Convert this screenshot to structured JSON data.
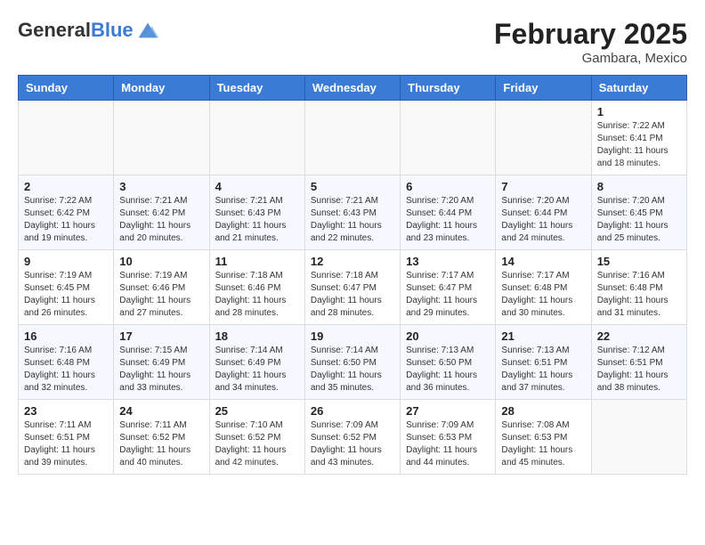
{
  "header": {
    "logo_general": "General",
    "logo_blue": "Blue",
    "month_year": "February 2025",
    "location": "Gambara, Mexico"
  },
  "calendar": {
    "days_of_week": [
      "Sunday",
      "Monday",
      "Tuesday",
      "Wednesday",
      "Thursday",
      "Friday",
      "Saturday"
    ],
    "weeks": [
      [
        {
          "day": "",
          "info": ""
        },
        {
          "day": "",
          "info": ""
        },
        {
          "day": "",
          "info": ""
        },
        {
          "day": "",
          "info": ""
        },
        {
          "day": "",
          "info": ""
        },
        {
          "day": "",
          "info": ""
        },
        {
          "day": "1",
          "info": "Sunrise: 7:22 AM\nSunset: 6:41 PM\nDaylight: 11 hours and 18 minutes."
        }
      ],
      [
        {
          "day": "2",
          "info": "Sunrise: 7:22 AM\nSunset: 6:42 PM\nDaylight: 11 hours and 19 minutes."
        },
        {
          "day": "3",
          "info": "Sunrise: 7:21 AM\nSunset: 6:42 PM\nDaylight: 11 hours and 20 minutes."
        },
        {
          "day": "4",
          "info": "Sunrise: 7:21 AM\nSunset: 6:43 PM\nDaylight: 11 hours and 21 minutes."
        },
        {
          "day": "5",
          "info": "Sunrise: 7:21 AM\nSunset: 6:43 PM\nDaylight: 11 hours and 22 minutes."
        },
        {
          "day": "6",
          "info": "Sunrise: 7:20 AM\nSunset: 6:44 PM\nDaylight: 11 hours and 23 minutes."
        },
        {
          "day": "7",
          "info": "Sunrise: 7:20 AM\nSunset: 6:44 PM\nDaylight: 11 hours and 24 minutes."
        },
        {
          "day": "8",
          "info": "Sunrise: 7:20 AM\nSunset: 6:45 PM\nDaylight: 11 hours and 25 minutes."
        }
      ],
      [
        {
          "day": "9",
          "info": "Sunrise: 7:19 AM\nSunset: 6:45 PM\nDaylight: 11 hours and 26 minutes."
        },
        {
          "day": "10",
          "info": "Sunrise: 7:19 AM\nSunset: 6:46 PM\nDaylight: 11 hours and 27 minutes."
        },
        {
          "day": "11",
          "info": "Sunrise: 7:18 AM\nSunset: 6:46 PM\nDaylight: 11 hours and 28 minutes."
        },
        {
          "day": "12",
          "info": "Sunrise: 7:18 AM\nSunset: 6:47 PM\nDaylight: 11 hours and 28 minutes."
        },
        {
          "day": "13",
          "info": "Sunrise: 7:17 AM\nSunset: 6:47 PM\nDaylight: 11 hours and 29 minutes."
        },
        {
          "day": "14",
          "info": "Sunrise: 7:17 AM\nSunset: 6:48 PM\nDaylight: 11 hours and 30 minutes."
        },
        {
          "day": "15",
          "info": "Sunrise: 7:16 AM\nSunset: 6:48 PM\nDaylight: 11 hours and 31 minutes."
        }
      ],
      [
        {
          "day": "16",
          "info": "Sunrise: 7:16 AM\nSunset: 6:48 PM\nDaylight: 11 hours and 32 minutes."
        },
        {
          "day": "17",
          "info": "Sunrise: 7:15 AM\nSunset: 6:49 PM\nDaylight: 11 hours and 33 minutes."
        },
        {
          "day": "18",
          "info": "Sunrise: 7:14 AM\nSunset: 6:49 PM\nDaylight: 11 hours and 34 minutes."
        },
        {
          "day": "19",
          "info": "Sunrise: 7:14 AM\nSunset: 6:50 PM\nDaylight: 11 hours and 35 minutes."
        },
        {
          "day": "20",
          "info": "Sunrise: 7:13 AM\nSunset: 6:50 PM\nDaylight: 11 hours and 36 minutes."
        },
        {
          "day": "21",
          "info": "Sunrise: 7:13 AM\nSunset: 6:51 PM\nDaylight: 11 hours and 37 minutes."
        },
        {
          "day": "22",
          "info": "Sunrise: 7:12 AM\nSunset: 6:51 PM\nDaylight: 11 hours and 38 minutes."
        }
      ],
      [
        {
          "day": "23",
          "info": "Sunrise: 7:11 AM\nSunset: 6:51 PM\nDaylight: 11 hours and 39 minutes."
        },
        {
          "day": "24",
          "info": "Sunrise: 7:11 AM\nSunset: 6:52 PM\nDaylight: 11 hours and 40 minutes."
        },
        {
          "day": "25",
          "info": "Sunrise: 7:10 AM\nSunset: 6:52 PM\nDaylight: 11 hours and 42 minutes."
        },
        {
          "day": "26",
          "info": "Sunrise: 7:09 AM\nSunset: 6:52 PM\nDaylight: 11 hours and 43 minutes."
        },
        {
          "day": "27",
          "info": "Sunrise: 7:09 AM\nSunset: 6:53 PM\nDaylight: 11 hours and 44 minutes."
        },
        {
          "day": "28",
          "info": "Sunrise: 7:08 AM\nSunset: 6:53 PM\nDaylight: 11 hours and 45 minutes."
        },
        {
          "day": "",
          "info": ""
        }
      ]
    ]
  }
}
